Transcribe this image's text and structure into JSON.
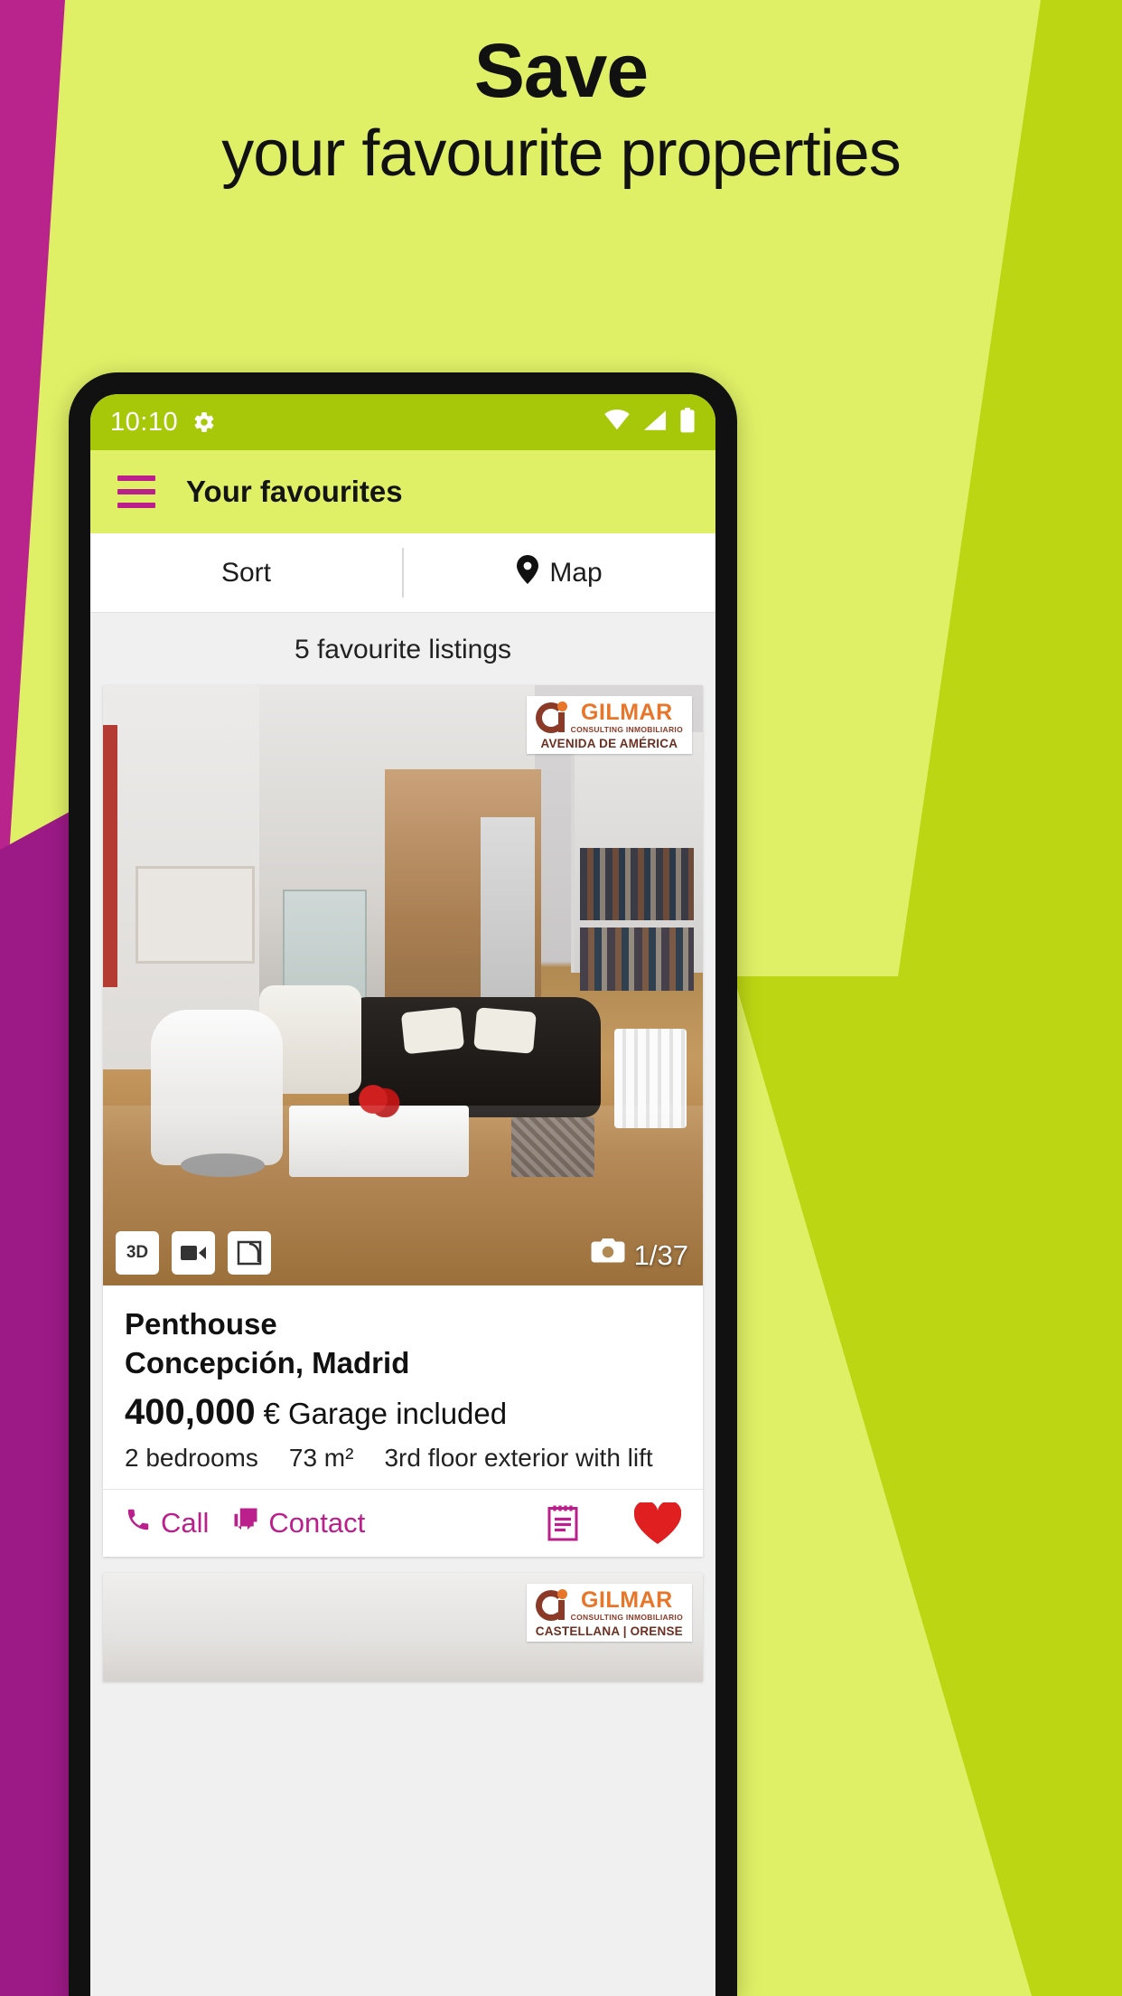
{
  "promo": {
    "line1": "Save",
    "line2": "your favourite properties",
    "bg_color": "#e0f066",
    "accent_olive": "#bcd613",
    "accent_magenta": "#b8248c"
  },
  "status_bar": {
    "time": "10:10",
    "gear_icon": "gear-icon",
    "wifi_icon": "wifi-icon",
    "signal_icon": "signal-icon",
    "battery_icon": "battery-icon",
    "bg_color": "#a7c808"
  },
  "app_bar": {
    "menu_icon": "hamburger-menu-icon",
    "title": "Your favourites",
    "bg_color": "#e0f066",
    "icon_color": "#bb1f8c"
  },
  "tabs": [
    {
      "label": "Sort",
      "icon": null
    },
    {
      "label": "Map",
      "icon": "map-pin-icon"
    }
  ],
  "list": {
    "count_label": "5 favourite listings",
    "listings": [
      {
        "watermark": {
          "brand": "GILMAR",
          "tagline": "CONSULTING INMOBILIARIO",
          "branch": "AVENIDA DE AMÉRICA"
        },
        "badges": [
          "3D",
          "video-icon",
          "floorplan-icon"
        ],
        "photo_counter": "1/37",
        "camera_icon": "camera-icon",
        "property_type": "Penthouse",
        "location": "Concepción, Madrid",
        "price": "400,000",
        "currency": "€",
        "price_extra": "Garage included",
        "features": [
          "2 bedrooms",
          "73 m²",
          "3rd floor exterior with lift"
        ],
        "actions": {
          "call_label": "Call",
          "call_icon": "phone-icon",
          "contact_label": "Contact",
          "contact_icon": "chat-icon",
          "notes_icon": "notes-icon",
          "favourite_icon": "heart-icon",
          "accent_color": "#bb1f8c",
          "favourite_color": "#e02020"
        }
      },
      {
        "watermark": {
          "brand": "GILMAR",
          "tagline": "CONSULTING INMOBILIARIO",
          "branch": "CASTELLANA | ORENSE"
        }
      }
    ]
  }
}
